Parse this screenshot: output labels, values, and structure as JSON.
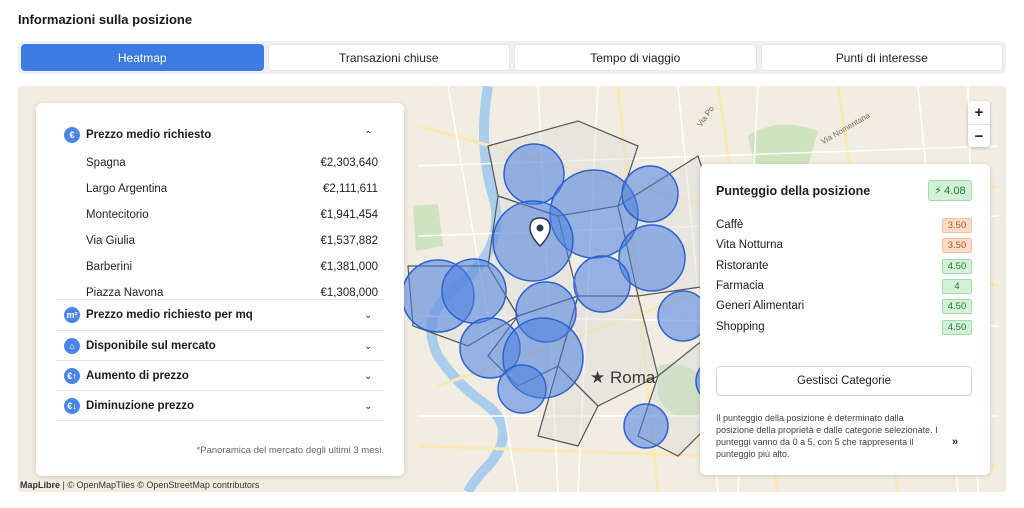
{
  "header": {
    "title": "Informazioni sulla posizione"
  },
  "tabs": [
    {
      "label": "Heatmap",
      "active": true
    },
    {
      "label": "Transazioni chiuse",
      "active": false
    },
    {
      "label": "Tempo di viaggio",
      "active": false
    },
    {
      "label": "Punti di interesse",
      "active": false
    }
  ],
  "left_panel": {
    "sections": [
      {
        "icon": "euro-icon",
        "label": "Prezzo medio richiesto",
        "expanded": true
      },
      {
        "icon": "square-meter-icon",
        "label": "Prezzo medio richiesto per mq",
        "expanded": false
      },
      {
        "icon": "home-icon",
        "label": "Disponibile sul mercato",
        "expanded": false
      },
      {
        "icon": "price-increase-icon",
        "label": "Aumento di prezzo",
        "expanded": false
      },
      {
        "icon": "price-decrease-icon",
        "label": "Diminuzione prezzo",
        "expanded": false
      }
    ],
    "rows": [
      {
        "name": "Spagna",
        "value": "€2,303,640"
      },
      {
        "name": "Largo Argentina",
        "value": "€2,111,611"
      },
      {
        "name": "Montecitorio",
        "value": "€1,941,454"
      },
      {
        "name": "Via Giulia",
        "value": "€1,537,882"
      },
      {
        "name": "Barberini",
        "value": "€1,381,000"
      },
      {
        "name": "Piazza Navona",
        "value": "€1,308,000"
      }
    ],
    "footnote": "*Panoramica del mercato degli ultimi 3 mesi."
  },
  "score_panel": {
    "title": "Punteggio della posizione",
    "score": "4.08",
    "categories": [
      {
        "name": "Caffè",
        "score": "3.50",
        "tone": "orange"
      },
      {
        "name": "Vita Notturna",
        "score": "3.50",
        "tone": "orange"
      },
      {
        "name": "Ristorante",
        "score": "4.50",
        "tone": "green"
      },
      {
        "name": "Farmacia",
        "score": "4",
        "tone": "green"
      },
      {
        "name": "Generi Alimentari",
        "score": "4.50",
        "tone": "green"
      },
      {
        "name": "Shopping",
        "score": "4.50",
        "tone": "green"
      }
    ],
    "manage_label": "Gestisci Categorie",
    "info": "Il punteggio della posizione è determinato dalla posizione della proprietà e dalle categorie selezionate. I punteggi vanno da 0 a 5, con 5 che rappresenta il punteggio più alto.",
    "more_label": "»"
  },
  "map": {
    "city_label": "Roma",
    "street_labels": [
      "Via Nomentana",
      "Via Po"
    ],
    "zoom_in": "+",
    "zoom_out": "−",
    "attribution_brand": "MapLibre",
    "attribution_text": "| © OpenMapTiles © OpenStreetMap contributors",
    "colors": {
      "heat_fill": "#4a7fe0",
      "heat_stroke": "#2e63cf",
      "water": "#a9cdeb",
      "park": "#cfe3c0"
    }
  }
}
